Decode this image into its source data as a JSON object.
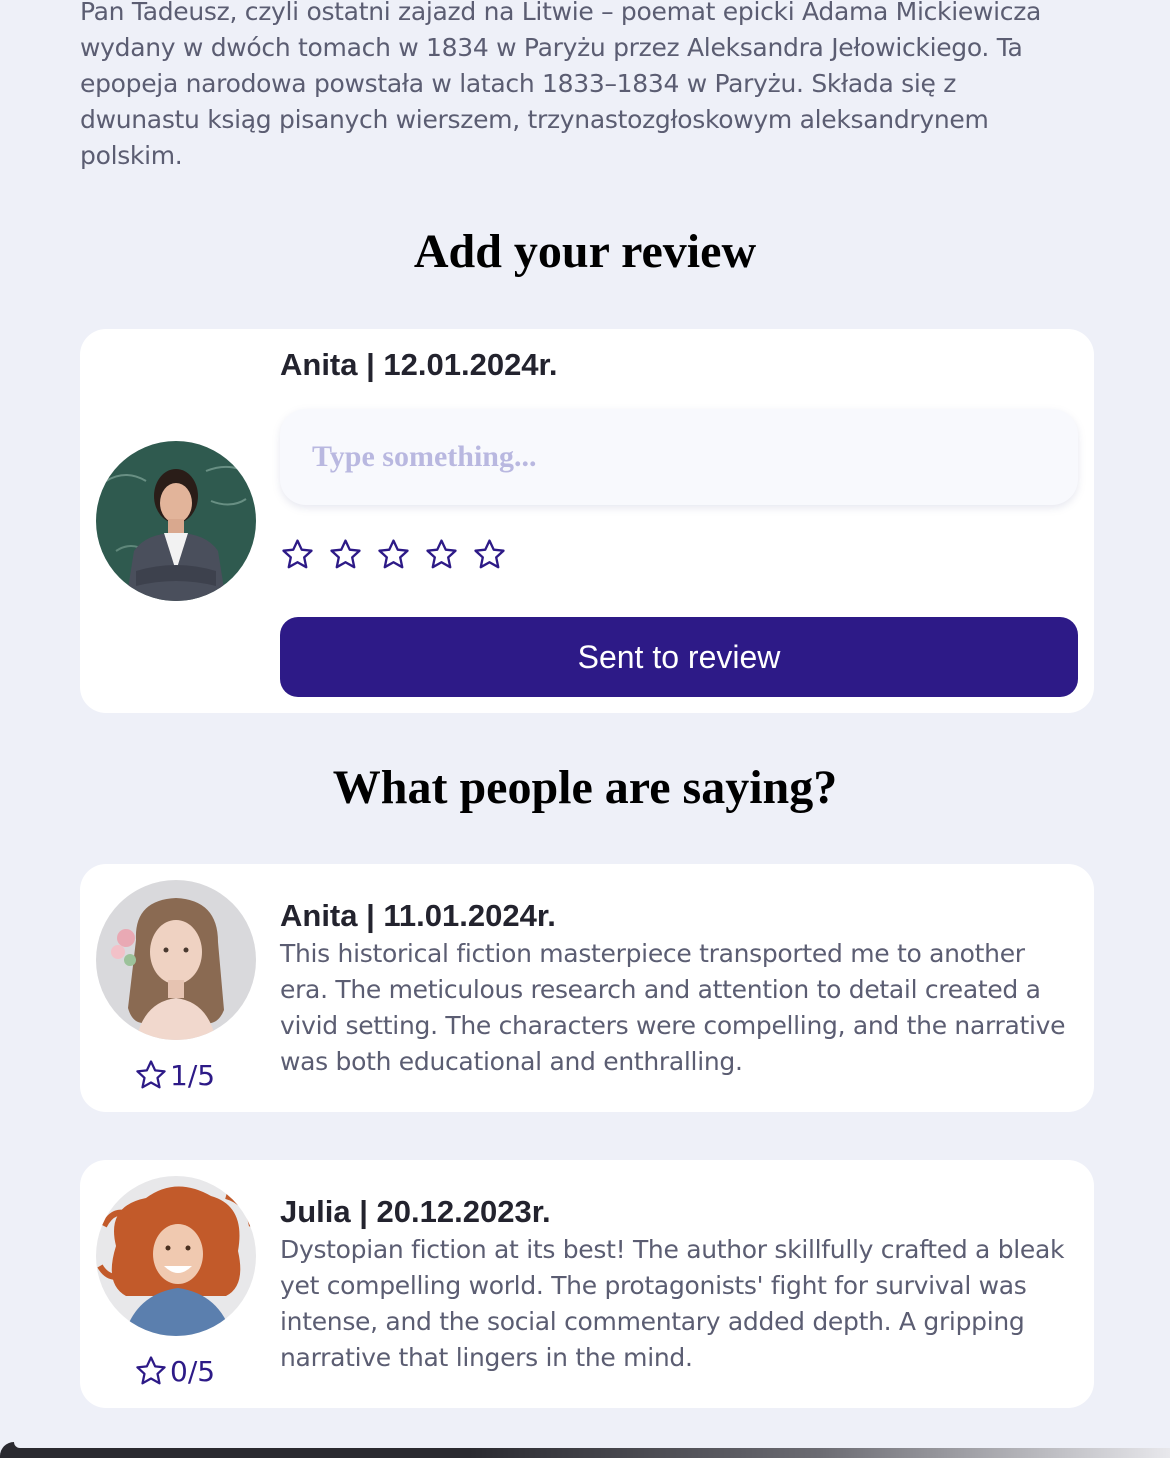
{
  "intro": {
    "text": "Pan Tadeusz, czyli ostatni zajazd na Litwie – poemat epicki Adama Mickiewicza wydany w dwóch tomach w 1834 w Paryżu przez Aleksandra Jełowickiego. Ta epopeja narodowa powstała w latach 1833–1834 w Paryżu. Składa się z dwunastu ksiąg pisanych wierszem, trzynastozgłoskowym aleksandrynem polskim."
  },
  "add_review": {
    "title": "Add your review",
    "author": "Anita | 12.01.2024r.",
    "input_placeholder": "Type something...",
    "input_value": "",
    "star_count": 5,
    "selected_stars": 0,
    "submit_label": "Sent to review"
  },
  "reviews_section": {
    "title": "What people are saying?",
    "reviews": [
      {
        "author": "Anita | 11.01.2024r.",
        "text": "This historical fiction masterpiece transported me to another era. The meticulous research and attention to detail created a vivid setting. The characters were compelling, and the narrative was both educational and enthralling.",
        "rating": "1/5"
      },
      {
        "author": "Julia | 20.12.2023r.",
        "text": "Dystopian fiction at its best! The author skillfully crafted a bleak yet compelling world. The protagonists' fight for survival was intense, and the social commentary added depth. A gripping narrative that lingers in the mind.",
        "rating": "0/5"
      }
    ]
  },
  "icons": {
    "star": "star-outline-icon"
  },
  "colors": {
    "accent": "#2d1a87",
    "background": "#eef0f8",
    "card": "#ffffff",
    "body_text": "#5b5d72",
    "placeholder": "#b9b8e0"
  }
}
